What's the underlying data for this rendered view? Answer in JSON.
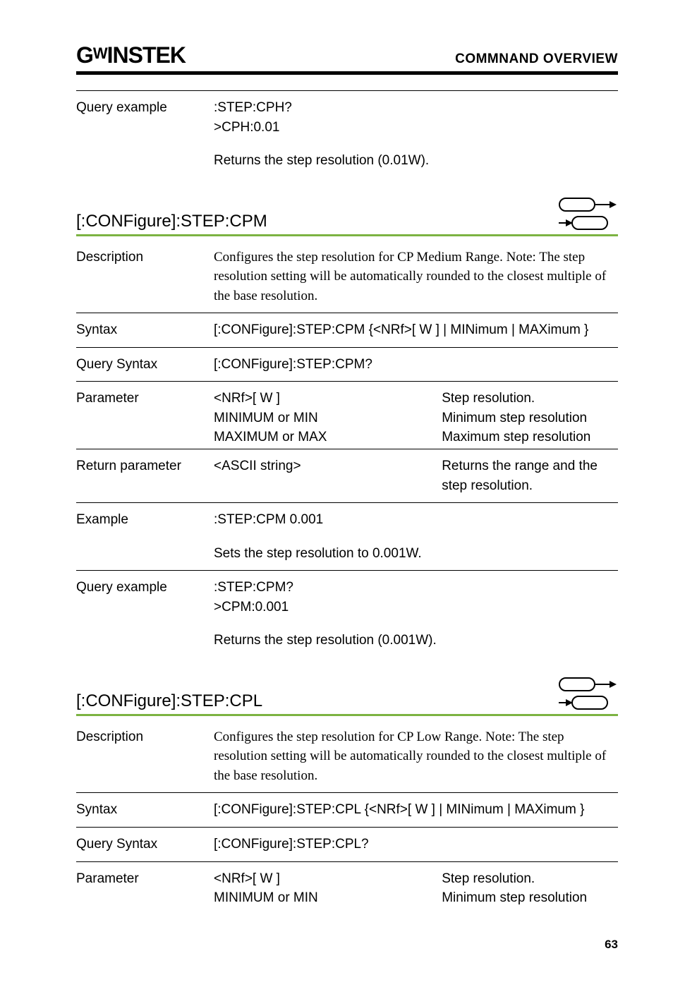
{
  "header": {
    "logo_prefix": "G",
    "logo_mid": "W",
    "logo_suffix": "INSTEK",
    "breadcrumb": "COMMNAND OVERVIEW"
  },
  "top_block": {
    "query_example_label": "Query example",
    "query_example_line1": ":STEP:CPH?",
    "query_example_line2": ">CPH:0.01",
    "returns_text": "Returns the step resolution (0.01W)."
  },
  "section_cpm": {
    "title": "[:CONFigure]:STEP:CPM",
    "description_label": "Description",
    "description_text": "Configures the step resolution for CP Medium Range. Note: The step resolution setting will be automatically rounded to the closest multiple of the base resolution.",
    "syntax_label": "Syntax",
    "syntax_text": "[:CONFigure]:STEP:CPM {<NRf>[ W ] | MINimum | MAXimum }",
    "query_syntax_label": "Query Syntax",
    "query_syntax_text": "[:CONFigure]:STEP:CPM?",
    "parameter_label": "Parameter",
    "param_nrf": "<NRf>[ W ]",
    "param_nrf_desc": "Step resolution.",
    "param_min": "MINIMUM or MIN",
    "param_min_desc": "Minimum step resolution",
    "param_max": "MAXIMUM or MAX",
    "param_max_desc": "Maximum step resolution",
    "return_param_label": "Return parameter",
    "return_param_val": "<ASCII string>",
    "return_param_desc": "Returns the range and the step resolution.",
    "example_label": "Example",
    "example_text": ":STEP:CPM 0.001",
    "example_desc": "Sets the step resolution to 0.001W.",
    "query_example_label": "Query example",
    "query_example_line1": ":STEP:CPM?",
    "query_example_line2": ">CPM:0.001",
    "returns_text": "Returns the step resolution (0.001W)."
  },
  "section_cpl": {
    "title": "[:CONFigure]:STEP:CPL",
    "description_label": "Description",
    "description_text": "Configures the step resolution for CP Low Range. Note: The step resolution setting will be automatically rounded to the closest multiple of the base resolution.",
    "syntax_label": "Syntax",
    "syntax_text": "[:CONFigure]:STEP:CPL {<NRf>[ W ] | MINimum | MAXimum }",
    "query_syntax_label": "Query Syntax",
    "query_syntax_text": "[:CONFigure]:STEP:CPL?",
    "parameter_label": "Parameter",
    "param_nrf": "<NRf>[ W ]",
    "param_nrf_desc": "Step resolution.",
    "param_min": "MINIMUM or MIN",
    "param_min_desc": "Minimum step resolution"
  },
  "page_number": "63"
}
